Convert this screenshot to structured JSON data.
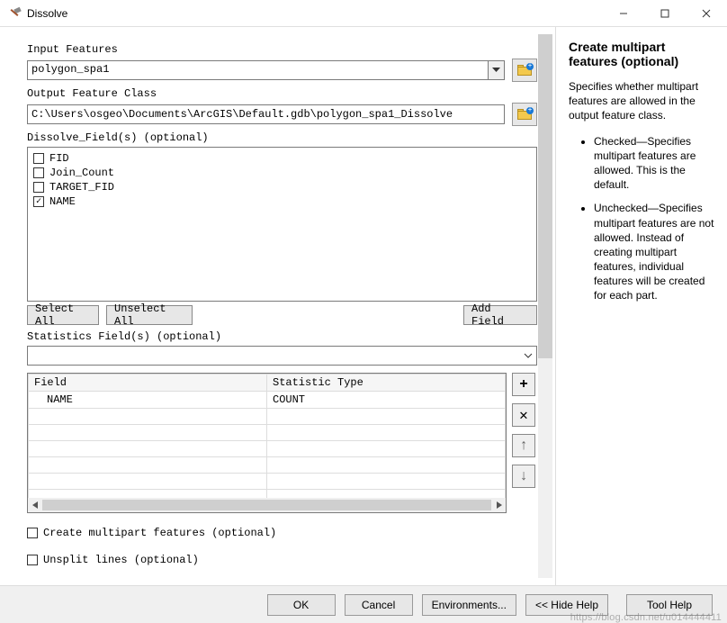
{
  "title": "Dissolve",
  "left": {
    "input_features": {
      "label": "Input Features",
      "value": "polygon_spa1"
    },
    "output": {
      "label": "Output Feature Class",
      "value": "C:\\Users\\osgeo\\Documents\\ArcGIS\\Default.gdb\\polygon_spa1_Dissolve"
    },
    "dissolve_fields": {
      "label": "Dissolve_Field(s) (optional)",
      "items": [
        {
          "name": "FID",
          "checked": false
        },
        {
          "name": "Join_Count",
          "checked": false
        },
        {
          "name": "TARGET_FID",
          "checked": false
        },
        {
          "name": "NAME",
          "checked": true
        }
      ],
      "select_all": "Select All",
      "unselect_all": "Unselect All",
      "add_field": "Add Field"
    },
    "stats": {
      "label": "Statistics Field(s) (optional)",
      "col_field": "Field",
      "col_type": "Statistic Type",
      "rows": [
        {
          "field": "NAME",
          "type": "COUNT"
        }
      ]
    },
    "multipart": {
      "label": "Create multipart features (optional)",
      "checked": false
    },
    "unsplit": {
      "label": "Unsplit lines (optional)",
      "checked": false
    }
  },
  "right": {
    "title": "Create multipart features (optional)",
    "para": "Specifies whether multipart features are allowed in the output feature class.",
    "bullet1": "Checked—Specifies multipart features are allowed. This is the default.",
    "bullet2": "Unchecked—Specifies multipart features are not allowed. Instead of creating multipart features, individual features will be created for each part."
  },
  "footer": {
    "ok": "OK",
    "cancel": "Cancel",
    "env": "Environments...",
    "hide": "<< Hide Help",
    "tool_help": "Tool Help"
  },
  "watermark": "https://blog.csdn.net/u014444411"
}
